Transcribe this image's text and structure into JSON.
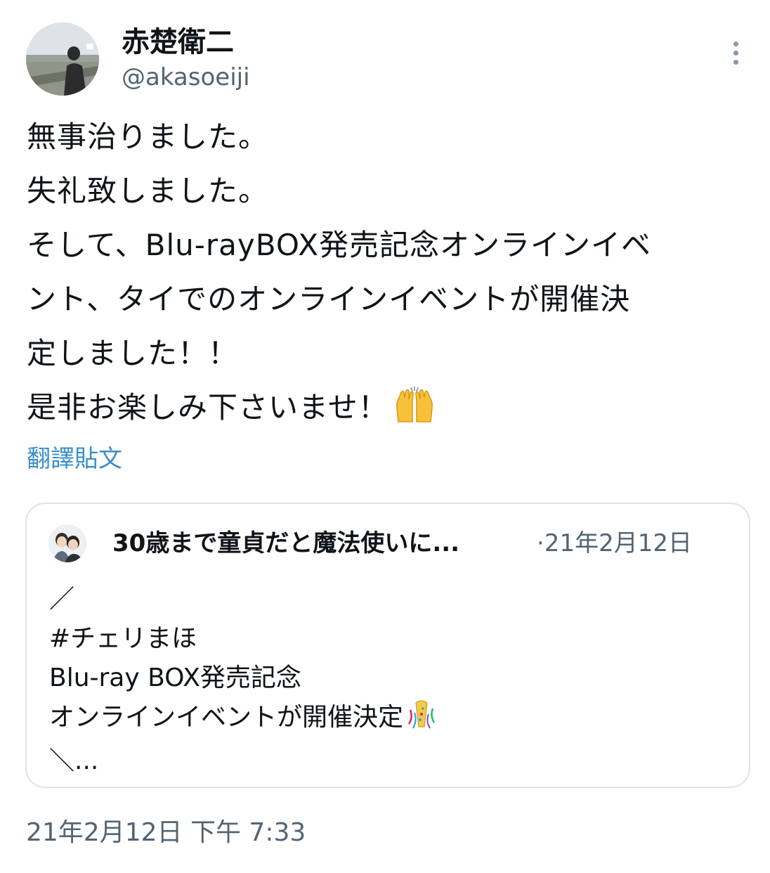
{
  "author": {
    "display_name": "赤楚衛二",
    "handle": "@akasoeiji"
  },
  "tweet": {
    "lines": [
      "無事治りました。",
      "失礼致しました。",
      "そして、Blu-rayBOX発売記念オンラインイベ",
      "ント、タイでのオンラインイベントが開催決",
      "定しました！！",
      "是非お楽しみ下さいませ！"
    ],
    "end_emoji": "raising-hands-emoji",
    "translate_label": "翻譯貼文",
    "timestamp": "21年2月12日 下午 7:33"
  },
  "quote": {
    "name": "30歳まで童貞だと魔法使いに...",
    "date": "·21年2月12日",
    "lines": [
      "／",
      "#チェリまほ",
      "Blu-ray BOX発売記念",
      "オンラインイベントが開催決定",
      "＼..."
    ],
    "emoji": "party-popper-emoji"
  },
  "colors": {
    "text": "#0f1419",
    "secondary": "#536471",
    "link": "#3a8ec9",
    "border": "#dfe3e6"
  }
}
